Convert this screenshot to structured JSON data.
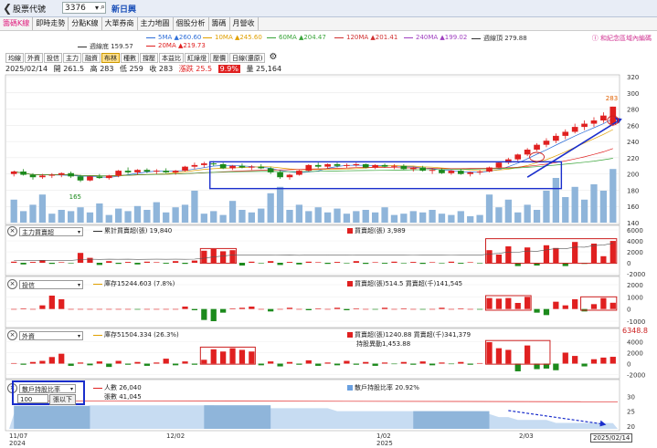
{
  "header": {
    "label": "股票代號",
    "code": "3376",
    "name": "新日興"
  },
  "tabs": [
    "籌碼K線",
    "即時走勢",
    "分點K線",
    "大單券商",
    "主力地圖",
    "個股分析",
    "籌碼",
    "月營收"
  ],
  "ma_legend": [
    {
      "label": "5MA ▲260.60",
      "color": "#2f6fd8"
    },
    {
      "label": "10MA ▲245.60",
      "color": "#e0a000"
    },
    {
      "label": "60MA ▲204.47",
      "color": "#3aa53a"
    },
    {
      "label": "120MA ▲201.41",
      "color": "#d03030"
    },
    {
      "label": "240MA ▲199.02",
      "color": "#a040c0"
    },
    {
      "label": "週線頂 279.88",
      "color": "#333333"
    },
    {
      "label": "週線底 159.57",
      "color": "#333333"
    },
    {
      "label": "20MA ▲219.73",
      "color": "#e02020"
    }
  ],
  "pin_text": "Ⓘ 和紀念區域內編碼",
  "toolbar": [
    "均線",
    "外資",
    "投信",
    "主力",
    "融資",
    "布林",
    "種數",
    "撐壓",
    "本益比",
    "紅綠燈",
    "壓價",
    "日線(還原)"
  ],
  "quote": {
    "date": "2025/02/14",
    "open": "開 261.5",
    "high": "高 283",
    "low": "低 259",
    "close": "收 283",
    "change": "漲跌 25.5",
    "pct": "9.9%",
    "volume": "量 25,164"
  },
  "price_axis": [
    "320",
    "300",
    "280",
    "260",
    "240",
    "220",
    "200",
    "180",
    "160",
    "140"
  ],
  "price_marks": {
    "high": "283",
    "low": "165"
  },
  "panels": {
    "main_force": {
      "select": "主力買賣超",
      "line_label": "累計買賣超(張) 19,840",
      "bar_label": "買賣超(張) 3,989",
      "axis": [
        "6000",
        "4000",
        "2000",
        "0",
        "-2000"
      ]
    },
    "trust": {
      "select": "投信",
      "line_label": "庫存15244.603 (7.8%)",
      "bar_label": "買賣超(張)514.5 買賣超(千)141,545",
      "axis": [
        "2000",
        "1000",
        "0",
        "-1000"
      ]
    },
    "foreign": {
      "select": "外資",
      "line_label": "庫存51504.334 (26.3%)",
      "bar_label": "買賣超(張)1240.88 買賣超(千)341,379",
      "bar_label2": "持股異動1,453.88",
      "axis_top": "6348.8",
      "axis": [
        "4000",
        "2000",
        "0",
        "-2000"
      ]
    },
    "holder": {
      "select": "散戶持股比率",
      "count_label": "人數 26,040",
      "shares_label": "張數 41,045",
      "ratio_label": "散戶持股比率 20.92%",
      "input": "100",
      "button": "張以下",
      "axis": [
        "30",
        "25",
        "20"
      ]
    }
  },
  "x_axis": [
    {
      "label": "11/07\n2024"
    },
    {
      "label": "12/02"
    },
    {
      "label": "1/02\n2025"
    },
    {
      "label": "2/03"
    }
  ],
  "date_tip": "2025/02/14",
  "chart_data": {
    "type": "candlestick",
    "price_range": [
      140,
      320
    ],
    "candles": [
      [
        200,
        204,
        197,
        203
      ],
      [
        203,
        206,
        198,
        199
      ],
      [
        199,
        201,
        193,
        196
      ],
      [
        196,
        200,
        194,
        198
      ],
      [
        198,
        201,
        195,
        199
      ],
      [
        199,
        202,
        196,
        201
      ],
      [
        201,
        203,
        195,
        197
      ],
      [
        197,
        199,
        190,
        192
      ],
      [
        192,
        198,
        191,
        197
      ],
      [
        197,
        200,
        194,
        195
      ],
      [
        195,
        199,
        193,
        198
      ],
      [
        198,
        205,
        196,
        204
      ],
      [
        204,
        208,
        200,
        202
      ],
      [
        202,
        206,
        199,
        205
      ],
      [
        205,
        207,
        201,
        203
      ],
      [
        203,
        206,
        200,
        204
      ],
      [
        204,
        207,
        201,
        202
      ],
      [
        202,
        205,
        199,
        204
      ],
      [
        204,
        210,
        203,
        209
      ],
      [
        209,
        214,
        206,
        211
      ],
      [
        211,
        215,
        208,
        213
      ],
      [
        213,
        216,
        210,
        212
      ],
      [
        212,
        214,
        206,
        207
      ],
      [
        207,
        211,
        205,
        210
      ],
      [
        210,
        213,
        207,
        208
      ],
      [
        208,
        211,
        205,
        209
      ],
      [
        209,
        212,
        206,
        207
      ],
      [
        207,
        209,
        200,
        202
      ],
      [
        202,
        204,
        194,
        196
      ],
      [
        196,
        200,
        193,
        199
      ],
      [
        199,
        205,
        198,
        204
      ],
      [
        204,
        212,
        203,
        211
      ],
      [
        211,
        214,
        207,
        209
      ],
      [
        209,
        213,
        207,
        212
      ],
      [
        212,
        214,
        208,
        210
      ],
      [
        210,
        213,
        207,
        211
      ],
      [
        211,
        214,
        209,
        212
      ],
      [
        212,
        213,
        207,
        208
      ],
      [
        208,
        212,
        206,
        211
      ],
      [
        211,
        213,
        208,
        209
      ],
      [
        209,
        212,
        206,
        210
      ],
      [
        210,
        212,
        205,
        206
      ],
      [
        206,
        209,
        203,
        208
      ],
      [
        208,
        210,
        203,
        204
      ],
      [
        204,
        207,
        200,
        205
      ],
      [
        205,
        207,
        200,
        201
      ],
      [
        201,
        205,
        199,
        204
      ],
      [
        204,
        206,
        199,
        200
      ],
      [
        200,
        203,
        197,
        202
      ],
      [
        202,
        205,
        199,
        203
      ],
      [
        203,
        209,
        202,
        208
      ],
      [
        208,
        215,
        207,
        214
      ],
      [
        214,
        220,
        212,
        218
      ],
      [
        218,
        225,
        216,
        224
      ],
      [
        224,
        232,
        222,
        230
      ],
      [
        230,
        238,
        228,
        236
      ],
      [
        236,
        244,
        233,
        241
      ],
      [
        241,
        250,
        238,
        247
      ],
      [
        247,
        255,
        243,
        252
      ],
      [
        252,
        262,
        250,
        258
      ],
      [
        258,
        266,
        254,
        262
      ],
      [
        262,
        270,
        258,
        266
      ],
      [
        266,
        276,
        263,
        272
      ],
      [
        261.5,
        283,
        259,
        283
      ]
    ],
    "volume": [
      18,
      9,
      14,
      22,
      7,
      10,
      9,
      12,
      8,
      15,
      6,
      11,
      9,
      13,
      10,
      16,
      8,
      12,
      14,
      25,
      7,
      9,
      6,
      17,
      10,
      8,
      11,
      23,
      28,
      10,
      14,
      9,
      12,
      8,
      11,
      7,
      9,
      10,
      8,
      12,
      6,
      7,
      9,
      8,
      10,
      7,
      6,
      9,
      5,
      6,
      22,
      12,
      18,
      8,
      14,
      10,
      25,
      35,
      20,
      28,
      18,
      30,
      25,
      42
    ],
    "main_force_bars": [
      200,
      -300,
      150,
      500,
      -200,
      100,
      -100,
      1800,
      900,
      -400,
      300,
      -200,
      150,
      -300,
      200,
      100,
      -150,
      300,
      -200,
      400,
      2200,
      2500,
      2100,
      2300,
      -500,
      200,
      -100,
      300,
      -400,
      150,
      -300,
      200,
      100,
      -200,
      150,
      -100,
      300,
      -200,
      100,
      -150,
      200,
      -100,
      150,
      -200,
      100,
      -100,
      200,
      -150,
      100,
      -100,
      2300,
      1500,
      3000,
      -600,
      2800,
      -500,
      3200,
      2700,
      -600,
      3800,
      -200,
      3500,
      1200,
      3989
    ],
    "trust_bars": [
      0,
      50,
      0,
      300,
      1100,
      800,
      0,
      0,
      0,
      0,
      0,
      0,
      0,
      -50,
      0,
      0,
      0,
      0,
      200,
      -100,
      -900,
      -1000,
      -300,
      50,
      100,
      200,
      0,
      -200,
      0,
      100,
      0,
      -100,
      50,
      0,
      100,
      -100,
      50,
      0,
      -50,
      100,
      0,
      50,
      0,
      -50,
      0,
      100,
      0,
      50,
      0,
      -50,
      900,
      850,
      900,
      500,
      1000,
      -300,
      -500,
      600,
      300,
      800,
      -200,
      400,
      900,
      514.5
    ],
    "foreign_bars": [
      100,
      -200,
      300,
      500,
      1200,
      1800,
      -400,
      200,
      -300,
      400,
      -600,
      500,
      -200,
      300,
      -400,
      200,
      900,
      -300,
      400,
      -200,
      700,
      2600,
      2200,
      2800,
      2500,
      2200,
      -300,
      400,
      -500,
      300,
      -200,
      600,
      -400,
      200,
      -300,
      500,
      -200,
      300,
      -400,
      200,
      -100,
      300,
      -200,
      400,
      -300,
      200,
      -100,
      300,
      -200,
      100,
      3900,
      2800,
      2500,
      -1400,
      3300,
      -1000,
      -900,
      -1200,
      2000,
      1400,
      -500,
      800,
      1100,
      1240.88
    ],
    "holder_ratio": [
      24,
      24,
      25,
      25,
      25,
      26,
      26,
      26,
      27,
      27,
      27,
      27,
      27,
      27,
      27,
      27,
      27,
      27,
      27,
      27,
      27,
      27,
      26,
      26,
      26,
      26,
      26,
      26,
      26,
      26,
      26,
      26,
      26,
      26,
      25,
      25,
      25,
      25,
      25,
      25,
      25,
      25,
      25,
      25,
      25,
      25,
      25,
      25,
      25,
      25,
      24,
      23,
      23,
      22,
      22,
      22,
      22,
      21,
      21,
      21,
      21,
      21,
      21,
      20.92
    ]
  }
}
